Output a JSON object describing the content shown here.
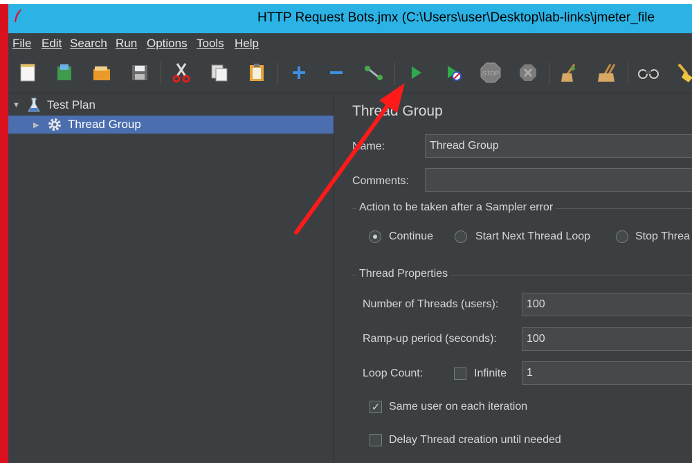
{
  "window": {
    "title": "HTTP Request Bots.jmx (C:\\Users\\user\\Desktop\\lab-links\\jmeter_file"
  },
  "menu": [
    "File",
    "Edit",
    "Search",
    "Run",
    "Options",
    "Tools",
    "Help"
  ],
  "toolbar": {
    "icons": [
      "new-icon",
      "templates-icon",
      "open-icon",
      "save-icon",
      "cut-icon",
      "copy-icon",
      "paste-icon",
      "expand-icon",
      "collapse-icon",
      "toggle-icon",
      "start-icon",
      "start-no-pauses-icon",
      "stop-icon",
      "shutdown-icon",
      "clear-icon",
      "clear-all-icon",
      "search-icon",
      "reset-search-icon"
    ]
  },
  "tree": {
    "items": [
      {
        "label": "Test Plan",
        "icon": "flask-icon"
      },
      {
        "label": "Thread Group",
        "icon": "gear-icon",
        "selected": true
      }
    ]
  },
  "panel": {
    "title": "Thread Group",
    "name_label": "Name:",
    "name_value": "Thread Group",
    "comments_label": "Comments:",
    "comments_value": "",
    "error_group_title": "Action to be taken after a Sampler error",
    "error_options": [
      "Continue",
      "Start Next Thread Loop",
      "Stop Threa"
    ],
    "error_selected": "Continue",
    "props_group_title": "Thread Properties",
    "threads_label": "Number of Threads (users):",
    "threads_value": "100",
    "rampup_label": "Ramp-up period (seconds):",
    "rampup_value": "100",
    "loop_label": "Loop Count:",
    "infinite_label": "Infinite",
    "infinite_checked": false,
    "loop_value": "1",
    "same_user_label": "Same user on each iteration",
    "same_user_checked": true,
    "delay_label": "Delay Thread creation until needed",
    "delay_checked": false
  },
  "colors": {
    "titlebar": "#2bb3e5",
    "background": "#3c3f41",
    "selection": "#4b6eaf",
    "annotation_arrow": "#ff1a1a"
  }
}
